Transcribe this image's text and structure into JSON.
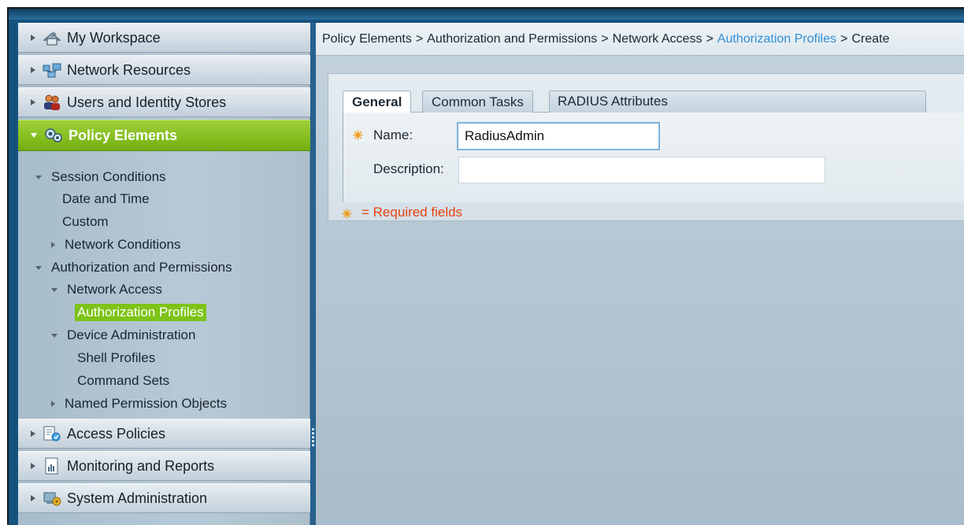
{
  "sidebar": {
    "drawers_top": [
      {
        "label": "My Workspace",
        "icon": "workspace-icon"
      },
      {
        "label": "Network Resources",
        "icon": "network-resources-icon"
      },
      {
        "label": "Users and Identity Stores",
        "icon": "users-icon"
      },
      {
        "label": "Policy Elements",
        "icon": "policy-elements-icon"
      }
    ],
    "tree": {
      "session_conditions": "Session Conditions",
      "date_and_time": "Date and Time",
      "custom": "Custom",
      "network_conditions": "Network Conditions",
      "auth_and_permissions": "Authorization and Permissions",
      "network_access": "Network Access",
      "authorization_profiles": "Authorization Profiles",
      "device_administration": "Device Administration",
      "shell_profiles": "Shell Profiles",
      "command_sets": "Command Sets",
      "named_permission_objects": "Named Permission Objects"
    },
    "drawers_bottom": [
      {
        "label": "Access Policies",
        "icon": "access-policies-icon"
      },
      {
        "label": "Monitoring and Reports",
        "icon": "monitoring-reports-icon"
      },
      {
        "label": "System Administration",
        "icon": "system-admin-icon"
      }
    ]
  },
  "breadcrumb": {
    "c1": "Policy Elements",
    "c2": "Authorization and Permissions",
    "c3": "Network Access",
    "c4": "Authorization Profiles",
    "c5": "Create",
    "sep": ">"
  },
  "tabs": [
    "General",
    "Common Tasks",
    "RADIUS Attributes"
  ],
  "form": {
    "name_label": "Name:",
    "name_value": "RadiusAdmin",
    "description_label": "Description:",
    "description_value": "",
    "required_note": "= Required fields"
  },
  "colors": {
    "active_drawer": "#86bf21",
    "selected_item": "#7dc317",
    "link": "#2f8fd6",
    "required": "#e8420e"
  }
}
